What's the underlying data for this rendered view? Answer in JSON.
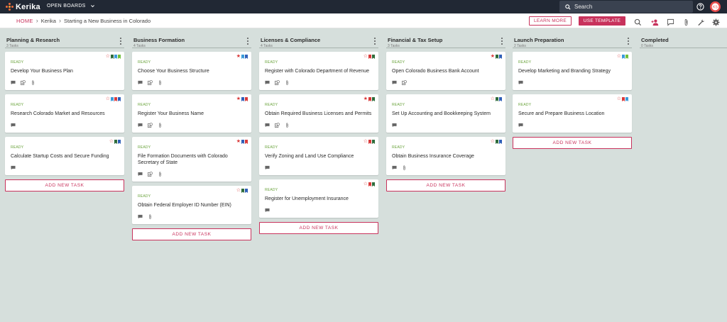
{
  "app": {
    "logo_text": "Kerika",
    "boards_menu": "OPEN BOARDS",
    "search_placeholder": "Search",
    "avatar_initials": "KS"
  },
  "subbar": {
    "breadcrumb": [
      "HOME",
      "Kerika",
      "Starting a New Business in Colorado"
    ],
    "learn_more": "LEARN MORE",
    "use_template": "USE TEMPLATE",
    "tools": [
      "search-icon",
      "add-person-icon",
      "chat-icon",
      "attachment-icon",
      "tools-icon",
      "settings-icon"
    ]
  },
  "colors": {
    "accent": "#c8325c",
    "ready": "#6aa33c",
    "star_red": "#d93a3a",
    "bm_green": "#2e6b3a",
    "bm_blue": "#2f5fb8",
    "bm_red": "#d93a3a",
    "bm_lightblue": "#3a9ad9",
    "bm_lightgreen": "#6fbf3a"
  },
  "columns": [
    {
      "title": "Planning & Research",
      "count": "3 Tasks",
      "add_label": "ADD NEW TASK",
      "cards": [
        {
          "status": "READY",
          "title": "Develop Your Business Plan",
          "star": "outline",
          "bookmarks": [
            "#2e6b3a",
            "#3a9ad9",
            "#6fbf3a"
          ],
          "icons": [
            "comment",
            "checklist",
            "attachment"
          ]
        },
        {
          "status": "READY",
          "title": "Research Colorado Market and Resources",
          "star": "outline",
          "bookmarks": [
            "#3a9ad9",
            "#d93a3a",
            "#2f5fb8"
          ],
          "icons": [
            "comment"
          ]
        },
        {
          "status": "READY",
          "title": "Calculate Startup Costs and Secure Funding",
          "star": "outline",
          "bookmarks": [
            "#2e6b3a",
            "#2f5fb8"
          ],
          "icons": [
            "comment"
          ]
        }
      ]
    },
    {
      "title": "Business Formation",
      "count": "4 Tasks",
      "add_label": "ADD NEW TASK",
      "cards": [
        {
          "status": "READY",
          "title": "Choose Your Business Structure",
          "star": "filled",
          "bookmarks": [
            "#3a9ad9",
            "#2f5fb8"
          ],
          "icons": [
            "comment",
            "checklist",
            "attachment"
          ]
        },
        {
          "status": "READY",
          "title": "Register Your Business Name",
          "star": "filled",
          "bookmarks": [
            "#2f5fb8",
            "#d93a3a"
          ],
          "icons": [
            "comment",
            "checklist",
            "attachment"
          ]
        },
        {
          "status": "READY",
          "title": "File Formation Documents with Colorado Secretary of State",
          "star": "filled",
          "bookmarks": [
            "#2f5fb8",
            "#d93a3a"
          ],
          "icons": [
            "comment",
            "checklist",
            "attachment"
          ]
        },
        {
          "status": "READY",
          "title": "Obtain Federal Employer ID Number (EIN)",
          "star": "outline",
          "bookmarks": [
            "#2e6b3a",
            "#2f5fb8"
          ],
          "icons": [
            "comment",
            "attachment"
          ]
        }
      ]
    },
    {
      "title": "Licenses & Compliance",
      "count": "4 Tasks",
      "add_label": "ADD NEW TASK",
      "cards": [
        {
          "status": "READY",
          "title": "Register with Colorado Department of Revenue",
          "star": "outline",
          "bookmarks": [
            "#d93a3a",
            "#2e6b3a"
          ],
          "icons": [
            "comment",
            "checklist",
            "attachment"
          ]
        },
        {
          "status": "READY",
          "title": "Obtain Required Business Licenses and Permits",
          "star": "filled",
          "bookmarks": [
            "#d93a3a",
            "#2e6b3a"
          ],
          "icons": [
            "comment",
            "checklist",
            "attachment"
          ]
        },
        {
          "status": "READY",
          "title": "Verify Zoning and Land Use Compliance",
          "star": "outline",
          "bookmarks": [
            "#d93a3a",
            "#2e6b3a"
          ],
          "icons": [
            "comment"
          ]
        },
        {
          "status": "READY",
          "title": "Register for Unemployment Insurance",
          "star": "outline",
          "bookmarks": [
            "#d93a3a",
            "#2e6b3a"
          ],
          "icons": [
            "comment"
          ]
        }
      ]
    },
    {
      "title": "Financial & Tax Setup",
      "count": "3 Tasks",
      "add_label": "ADD NEW TASK",
      "cards": [
        {
          "status": "READY",
          "title": "Open Colorado Business Bank Account",
          "star": "filled",
          "bookmarks": [
            "#2e6b3a",
            "#2f5fb8"
          ],
          "icons": [
            "comment",
            "checklist"
          ]
        },
        {
          "status": "READY",
          "title": "Set Up Accounting and Bookkeeping System",
          "star": "outline",
          "bookmarks": [
            "#2e6b3a",
            "#2f5fb8"
          ],
          "icons": [
            "comment"
          ]
        },
        {
          "status": "READY",
          "title": "Obtain Business Insurance Coverage",
          "star": "outline",
          "bookmarks": [
            "#2e6b3a",
            "#2f5fb8"
          ],
          "icons": [
            "comment",
            "attachment"
          ]
        }
      ]
    },
    {
      "title": "Launch Preparation",
      "count": "2 Tasks",
      "add_label": "ADD NEW TASK",
      "cards": [
        {
          "status": "READY",
          "title": "Develop Marketing and Branding Strategy",
          "star": "outline",
          "bookmarks": [
            "#3a9ad9",
            "#6fbf3a"
          ],
          "icons": [
            "comment"
          ]
        },
        {
          "status": "READY",
          "title": "Secure and Prepare Business Location",
          "star": "outline",
          "bookmarks": [
            "#d93a3a",
            "#3a9ad9"
          ],
          "icons": [
            "comment"
          ]
        }
      ]
    },
    {
      "title": "Completed",
      "count": "0 Tasks",
      "add_label": "",
      "cards": []
    }
  ]
}
